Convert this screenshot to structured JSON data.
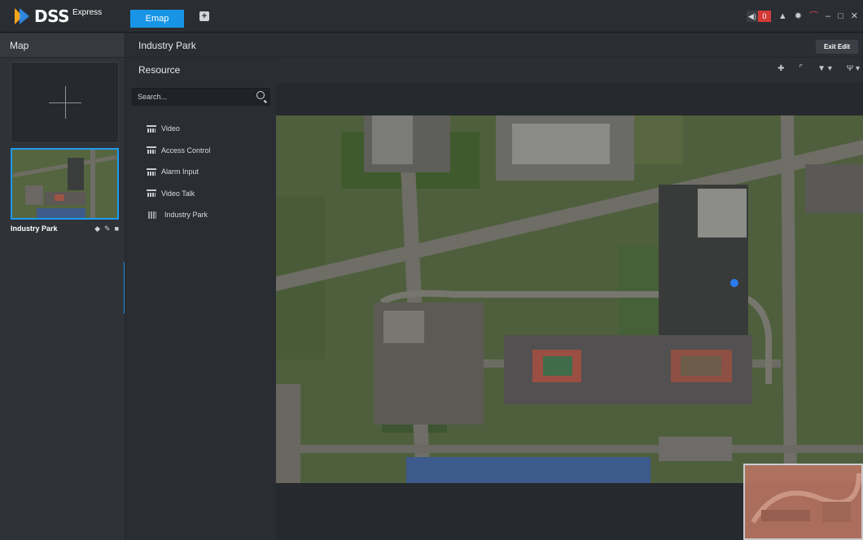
{
  "app": {
    "brand": "DSS",
    "edition": "Express"
  },
  "tabs": {
    "emap_label": "Emap",
    "add_label": "+"
  },
  "toolbar_sys": {
    "alarm_count": "0",
    "icons": [
      "speaker-icon",
      "user-icon",
      "gear-icon",
      "alarm-icon",
      "minimize-icon",
      "maximize-icon",
      "close-icon"
    ]
  },
  "left_panel": {
    "title": "Map",
    "maps": [
      {
        "name": "Industry Park"
      }
    ]
  },
  "mid_panel": {
    "title": "Industry Park",
    "resource_title": "Resource",
    "search_placeholder": "Search...",
    "tree": [
      {
        "label": "Video",
        "icon": "device-icon"
      },
      {
        "label": "Access Control",
        "icon": "device-icon"
      },
      {
        "label": "Alarm Input",
        "icon": "device-icon"
      },
      {
        "label": "Video Talk",
        "icon": "device-icon"
      },
      {
        "label": "Industry Park",
        "icon": "map-icon"
      }
    ]
  },
  "main": {
    "exit_edit_label": "Exit Edit"
  },
  "colors": {
    "accent": "#1794e6",
    "alarm_red": "#d43a36",
    "marker_blue": "#2a7cf0"
  }
}
